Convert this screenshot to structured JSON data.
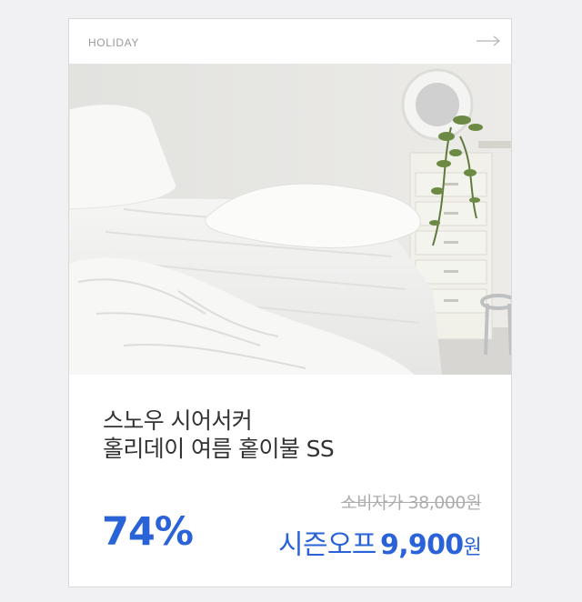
{
  "card": {
    "brand": "HOLIDAY",
    "image_alt": "white summer quilted blanket on a bed with pillows",
    "title_line1": "스노우 시어서커",
    "title_line2": "홀리데이 여름 홑이불 SS",
    "original_price": "소비자가 38,000원",
    "discount": "74%",
    "sale_label": "시즌오프",
    "sale_price": "9,900",
    "sale_unit": "원"
  },
  "icons": {
    "arrow": "arrow-right-icon"
  },
  "colors": {
    "accent": "#2a63d8",
    "muted": "#adadad",
    "text": "#333333",
    "border": "#d9d9d9"
  }
}
